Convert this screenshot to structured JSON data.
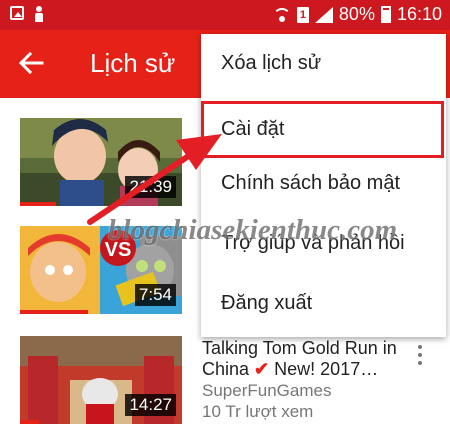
{
  "status_bar": {
    "sim_slot": "1",
    "battery": "80%",
    "time": "16:10"
  },
  "app_bar": {
    "title": "Lịch sử"
  },
  "menu": {
    "items": [
      {
        "label": "Xóa lịch sử"
      },
      {
        "label": "Cài đặt",
        "highlighted": true
      },
      {
        "label": "Chính sách bảo mật"
      },
      {
        "label": "Trợ giúp và phản hồi"
      },
      {
        "label": "Đăng xuất"
      }
    ]
  },
  "videos": [
    {
      "duration": "21:39",
      "watched_fraction": 0.22
    },
    {
      "duration": "7:54",
      "badge": "VS",
      "watched_fraction": 0.42
    },
    {
      "duration": "14:27",
      "watched_fraction": 0.12,
      "title_part1": "Talking Tom Gold Run in China",
      "check": "✔",
      "title_part2": "New! 2017…",
      "channel": "SuperFunGames",
      "views": "10 Tr lượt xem"
    }
  ],
  "watermark": "blogchiasekienthuc.com",
  "colors": {
    "brand": "#e62117",
    "status_bar": "#cc181e",
    "highlight_border": "#e31e24",
    "arrow": "#e31e24"
  }
}
